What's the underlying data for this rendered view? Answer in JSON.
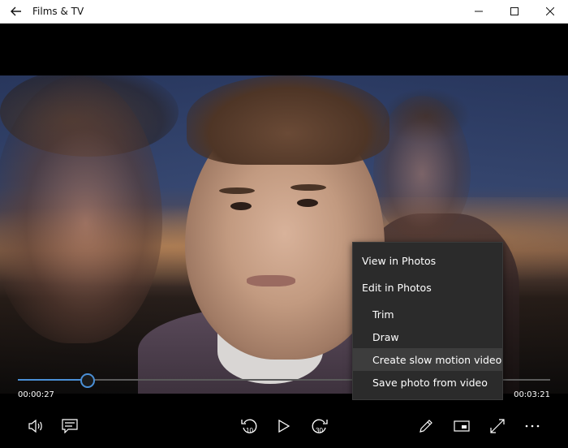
{
  "app": {
    "title": "Films & TV"
  },
  "player": {
    "elapsed": "00:00:27",
    "duration": "00:03:21",
    "progress_fraction": 0.13,
    "accent_color": "#4a8fd6"
  },
  "controls": {
    "volume_icon": "volume-icon",
    "subtitles_icon": "subtitles-icon",
    "skip_back": {
      "icon": "rewind-icon",
      "label": "10"
    },
    "play_icon": "play-icon",
    "skip_forward": {
      "icon": "fast-forward-icon",
      "label": "30"
    },
    "edit_icon": "pencil-icon",
    "miniview_icon": "mini-view-icon",
    "fullscreen_icon": "fullscreen-icon",
    "more_icon": "more-icon"
  },
  "context_menu": {
    "items": [
      {
        "label": "View in Photos"
      },
      {
        "label": "Edit in Photos"
      },
      {
        "label": "Trim"
      },
      {
        "label": "Draw"
      },
      {
        "label": "Create slow motion video"
      },
      {
        "label": "Save photo from video"
      }
    ]
  }
}
